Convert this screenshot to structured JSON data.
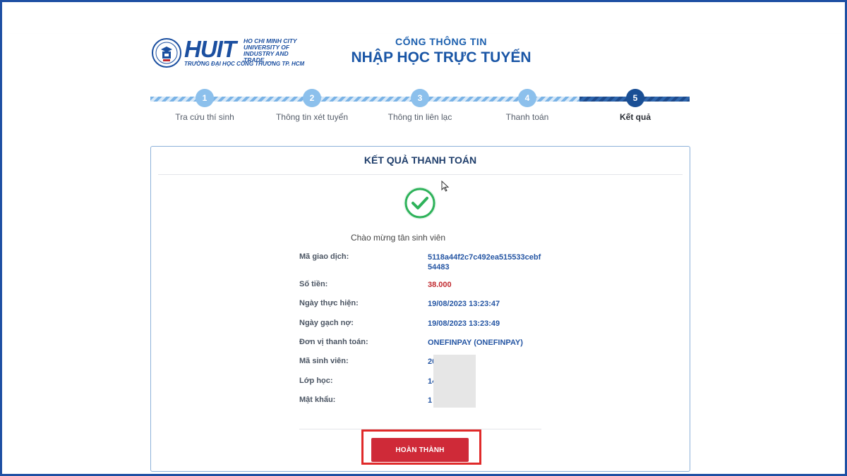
{
  "logo": {
    "word": "HUIT",
    "english_lines": [
      "HO CHI MINH CITY",
      "UNIVERSITY OF",
      "INDUSTRY AND TRADE"
    ],
    "vietnamese": "TRƯỜNG ĐẠI HỌC CÔNG THƯƠNG TP. HCM"
  },
  "portal": {
    "subtitle": "CỔNG THÔNG TIN",
    "title": "NHẬP HỌC TRỰC TUYẾN"
  },
  "stepper": {
    "active_step": 5,
    "steps": [
      {
        "number": "1",
        "label": "Tra cứu thí sinh"
      },
      {
        "number": "2",
        "label": "Thông tin xét tuyển"
      },
      {
        "number": "3",
        "label": "Thông tin liên lạc"
      },
      {
        "number": "4",
        "label": "Thanh toán"
      },
      {
        "number": "5",
        "label": "Kết quả"
      }
    ]
  },
  "result": {
    "title": "KẾT QUẢ THANH TOÁN",
    "welcome": "Chào mừng tân sinh viên",
    "fields": [
      {
        "label": "Mã giao dịch:",
        "value": "5118a44f2c7c492ea515533cebf54483"
      },
      {
        "label": "Số tiền:",
        "value": "38.000"
      },
      {
        "label": "Ngày thực hiện:",
        "value": "19/08/2023 13:23:47"
      },
      {
        "label": "Ngày gạch nợ:",
        "value": "19/08/2023 13:23:49"
      },
      {
        "label": "Đơn vị thanh toán:",
        "value": "ONEFINPAY (ONEFINPAY)"
      },
      {
        "label": "Mã sinh viên:",
        "value": "20"
      },
      {
        "label": "Lớp học:",
        "value": "14"
      },
      {
        "label": "Mật khẩu:",
        "value": "1"
      }
    ],
    "done_button": "HOÀN THÀNH"
  },
  "colors": {
    "brand_blue": "#1b4fa0",
    "accent_red": "#cf2a38",
    "success_green": "#2eb25a",
    "frame_blue": "#1e4fa3"
  }
}
